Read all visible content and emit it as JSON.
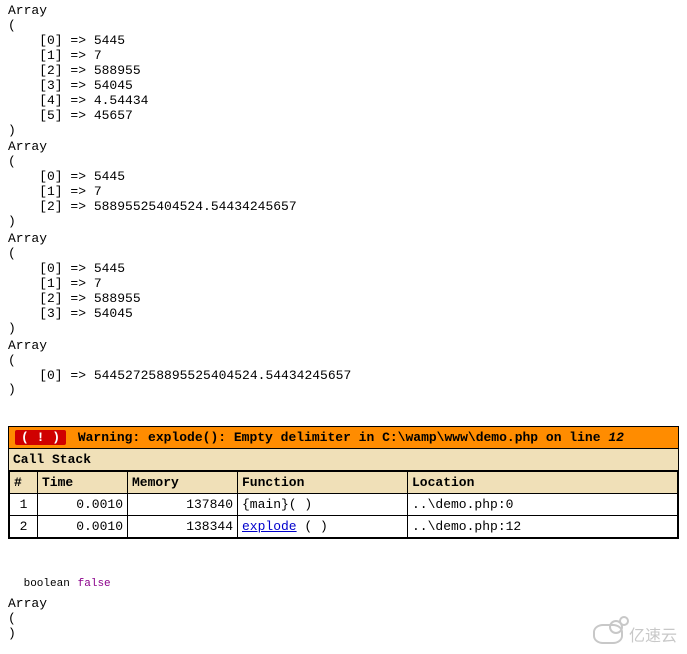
{
  "dumps": [
    {
      "label": "Array",
      "open": "(",
      "items": [
        "    [0] => 5445",
        "    [1] => 7",
        "    [2] => 588955",
        "    [3] => 54045",
        "    [4] => 4.54434",
        "    [5] => 45657"
      ],
      "close": ")"
    },
    {
      "label": "Array",
      "open": "(",
      "items": [
        "    [0] => 5445",
        "    [1] => 7",
        "    [2] => 58895525404524.54434245657"
      ],
      "close": ")"
    },
    {
      "label": "Array",
      "open": "(",
      "items": [
        "    [0] => 5445",
        "    [1] => 7",
        "    [2] => 588955",
        "    [3] => 54045"
      ],
      "close": ")"
    },
    {
      "label": "Array",
      "open": "(",
      "items": [
        "    [0] => 544527258895525404524.54434245657"
      ],
      "close": ")"
    }
  ],
  "xdebug": {
    "warn_icon": "( ! )",
    "warn_prefix": "Warning: explode(): Empty delimiter in C:\\wamp\\www\\demo.php on line ",
    "warn_line": "12",
    "callstack_title": "Call Stack",
    "headers": {
      "num": "#",
      "time": "Time",
      "memory": "Memory",
      "function": "Function",
      "location": "Location"
    },
    "rows": [
      {
        "num": "1",
        "time": "0.0010",
        "memory": "137840",
        "fn": "{main}( )",
        "fn_is_link": false,
        "loc": "..\\demo.php:0"
      },
      {
        "num": "2",
        "time": "0.0010",
        "memory": "138344",
        "fn_link": "explode",
        "fn_tail": " ( )",
        "fn_is_link": true,
        "loc": "..\\demo.php:12"
      }
    ]
  },
  "var_result": {
    "type": "boolean",
    "value": "false"
  },
  "tail_dump": {
    "label": "Array",
    "open": "(",
    "close": ")"
  },
  "watermark": "亿速云"
}
